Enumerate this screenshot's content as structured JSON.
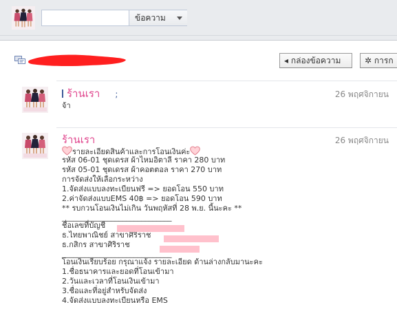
{
  "search": {
    "placeholder": "",
    "type_label": "ข้อความ"
  },
  "toolbar": {
    "inbox_label": "◂ กล่องข้อความ",
    "actions_label": "✲ การก"
  },
  "messages": [
    {
      "sender": "ร้านเรา",
      "suffix": ";",
      "date": "26 พฤศจิกายน",
      "lines": [
        "จ้า"
      ]
    },
    {
      "sender": "ร้านเรา",
      "date": "26 พฤศจิกายน",
      "heading": "รายละเอียดสินค้าและการโอนเงินค่ะ",
      "lines": [
        "รหัส 06-01 ชุดเดรส ผ้าไหมอิตาลี ราคา 280 บาท",
        "รหัส 05-01 ชุดเดรส ผ้าคอตตอล ราคา 270 บาท",
        "การจัดส่งให้เลือกระหว่าง",
        "1.จัดส่งแบบลงทะเบียนฟรี => ยอดโอน 550 บาท",
        "2.ค่าจัดส่งแบบEMS 40฿ => ยอดโอน 590 บาท",
        "** รบกวนโอนเงินไม่เกิน วันพฤหัสที่ 28 พ.ย. นี้นะคะ **",
        "_____________________________",
        "ชื่อเลขที่บัญชี",
        "ธ.ไทยพาณิชย์ สาขาศิริราช",
        "ธ.กสิกร สาขาศิริราช",
        "_____________________________",
        "โอนเงินเรียบร้อย กรุณาแจ้ง รายละเอียด ด้านล่างกลับมานะคะ",
        "1.ชื่อธนาคารและยอดที่โอนเข้ามา",
        "2.วันและเวลาที่โอนเงินเข้ามา",
        "3.ชื่อและที่อยู่สำหรับจัดส่ง",
        "4.จัดส่งแบบลงทะเบียนหรือ EMS"
      ]
    }
  ],
  "colors": {
    "accent_pink": "#e0448c",
    "header_bg": "#e9ebee",
    "redaction_red": "#ff1f1f",
    "redaction_pink": "#ffc1cc"
  }
}
